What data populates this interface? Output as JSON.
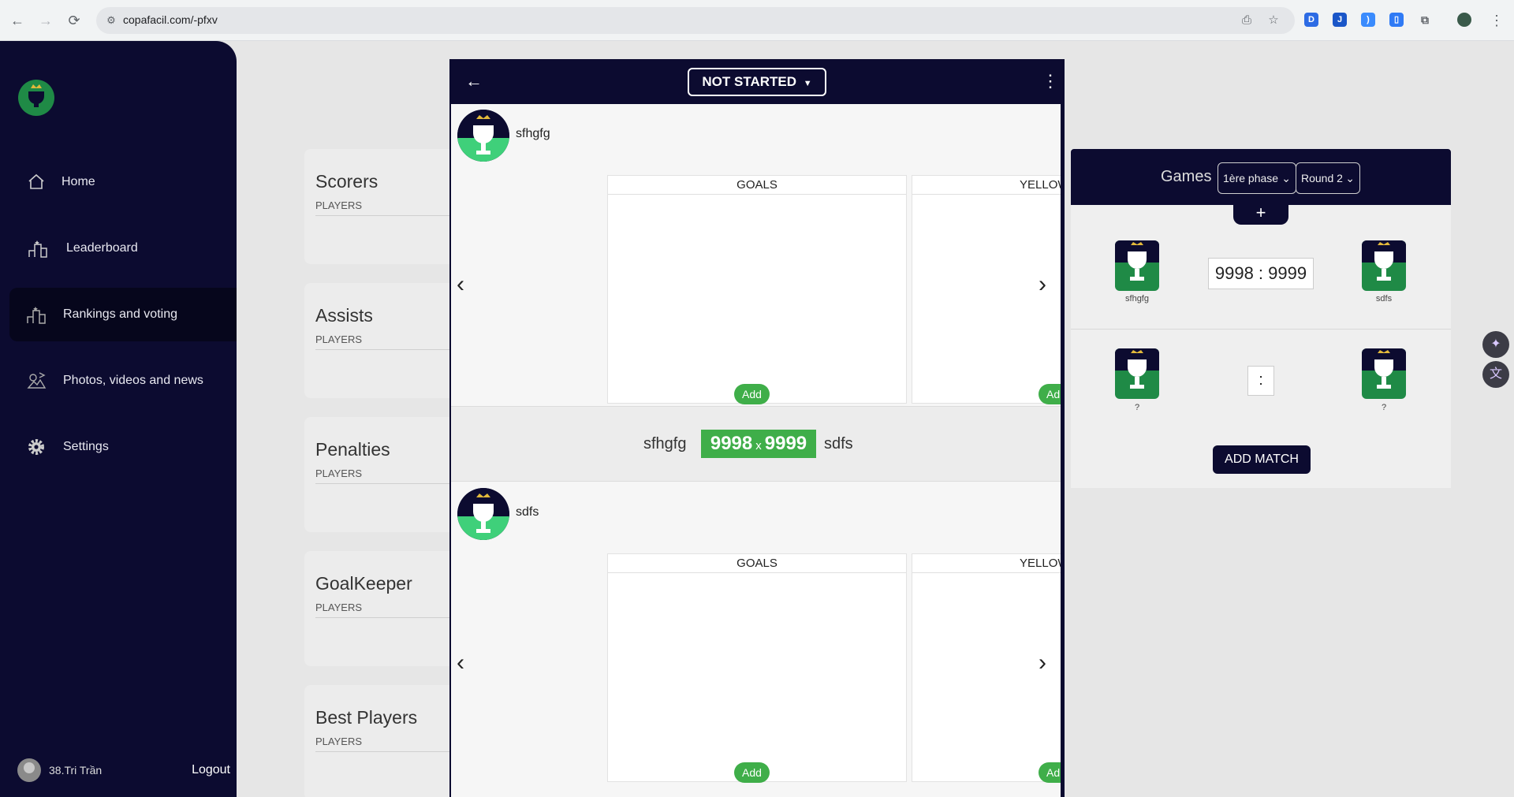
{
  "browser": {
    "url": "copafacil.com/-pfxv"
  },
  "sidebar": {
    "items": [
      {
        "label": "Home",
        "icon": "home-icon"
      },
      {
        "label": "Leaderboard",
        "icon": "podium-icon"
      },
      {
        "label": "Rankings and voting",
        "icon": "podium-icon"
      },
      {
        "label": "Photos, videos and news",
        "icon": "gallery-icon"
      },
      {
        "label": "Settings",
        "icon": "gear-icon"
      }
    ],
    "user": "38.Tri Trần",
    "logout": "Logout"
  },
  "stats": [
    {
      "title": "Scorers",
      "sub": "PLAYERS"
    },
    {
      "title": "Assists",
      "sub": "PLAYERS"
    },
    {
      "title": "Penalties",
      "sub": "PLAYERS"
    },
    {
      "title": "GoalKeeper",
      "sub": "PLAYERS"
    },
    {
      "title": "Best Players",
      "sub": "PLAYERS"
    }
  ],
  "games": {
    "title": "Games",
    "phase": "1ère phase",
    "round": "Round 2",
    "plus": "+",
    "match1": {
      "home": "sfhgfg",
      "score": "9998 : 9999",
      "away": "sdfs"
    },
    "match2": {
      "home": "?",
      "score": ":",
      "away": "?"
    },
    "add_match": "ADD MATCH"
  },
  "modal": {
    "status": "NOT STARTED",
    "home_team": "sfhgfg",
    "away_team": "sdfs",
    "home_score": "9998",
    "away_score": "9999",
    "separator": "x",
    "col_goals": "GOALS",
    "col_yellow": "YELLOW",
    "add_label": "Add",
    "add_label_cut": "Ad"
  },
  "colors": {
    "navy": "#0c0b30",
    "green": "#3fae49",
    "badge_green": "#1f8a46",
    "crown": "#e2b93b"
  }
}
